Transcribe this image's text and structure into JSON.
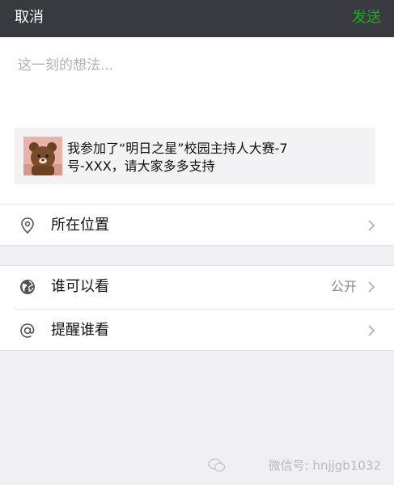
{
  "navbar": {
    "cancel_label": "取消",
    "send_label": "发送"
  },
  "compose": {
    "placeholder": "这一刻的想法...",
    "value": ""
  },
  "link_card": {
    "text_line1": "我参加了“明日之星”校园主持人大赛-7",
    "text_line2": "号-XXX，请大家多多支持",
    "thumbnail": "brown-bear-avatar"
  },
  "rows": [
    {
      "label": "所在位置",
      "value": "",
      "icon": "location-pin-icon"
    },
    {
      "label": "谁可以看",
      "value": "公开",
      "icon": "globe-icon"
    },
    {
      "label": "提醒谁看",
      "value": "",
      "icon": "at-sign-icon"
    }
  ],
  "watermark": {
    "text": "微信号: hnjjgb1032"
  },
  "colors": {
    "navbar_bg": "#393a3f",
    "send_green": "#1aad19",
    "page_bg": "#efeff4"
  }
}
